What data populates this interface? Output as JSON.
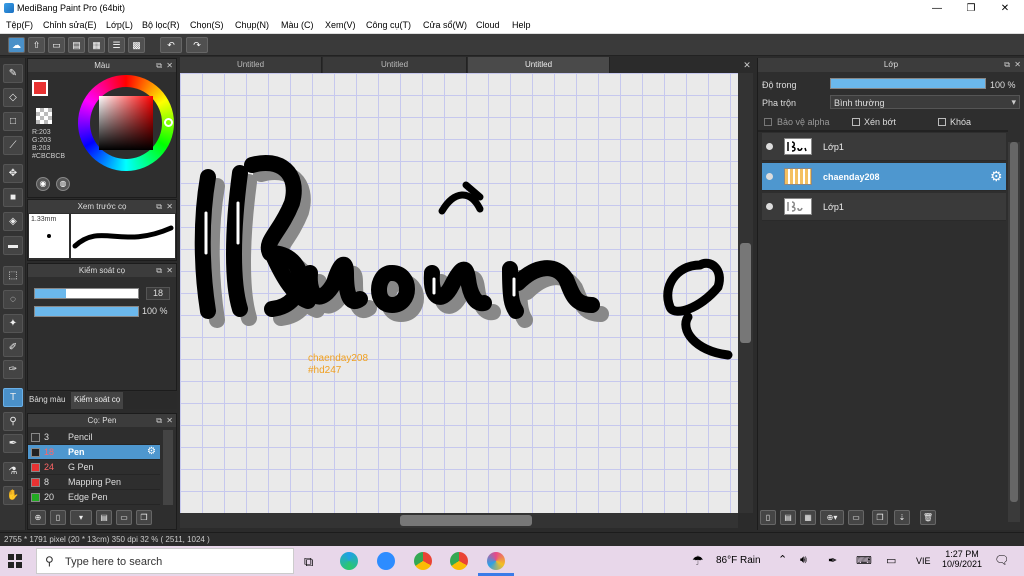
{
  "window": {
    "title": "MediBang Paint Pro (64bit)",
    "min": "—",
    "max": "❐",
    "close": "✕"
  },
  "menu": [
    "Tệp(F)",
    "Chỉnh sửa(E)",
    "Lớp(L)",
    "Bộ lọc(R)",
    "Chọn(S)",
    "Chụp(N)",
    "Màu (C)",
    "Xem(V)",
    "Công cụ(T)",
    "Cửa sổ(W)",
    "Cloud",
    "Help"
  ],
  "tabs": [
    "Untitled",
    "Untitled",
    "Untitled"
  ],
  "color_panel": {
    "title": "Màu",
    "r": "R:203",
    "g": "G:203",
    "b": "B:203",
    "hex": "#CBCBCB"
  },
  "preview_panel": {
    "title": "Xem trước cọ",
    "size": "1.33mm"
  },
  "brush_control": {
    "title": "Kiểm soát cọ",
    "size_value": "18",
    "opacity_value": "100 %",
    "size_fill": 0.3,
    "opacity_fill": 1.0
  },
  "panel_tabs": {
    "palette": "Bảng màu",
    "control": "Kiểm soát cọ"
  },
  "brush_panel": {
    "title": "Cọ: Pen",
    "items": [
      {
        "size": "3",
        "name": "Pencil",
        "color": "#333333"
      },
      {
        "size": "18",
        "name": "Pen",
        "color": "#222222"
      },
      {
        "size": "24",
        "name": "G Pen",
        "color": "#e83232"
      },
      {
        "size": "8",
        "name": "Mapping Pen",
        "color": "#e83232"
      },
      {
        "size": "20",
        "name": "Edge Pen",
        "color": "#22aa22"
      }
    ]
  },
  "layer_panel": {
    "title": "Lớp",
    "opacity_label": "Độ trong",
    "opacity_value": "100 %",
    "opacity_fill": 1.0,
    "blend_label": "Pha trộn",
    "blend_value": "Bình thường",
    "protect_alpha": "Bảo vệ alpha",
    "clip": "Xén bớt",
    "lock": "Khóa",
    "layers": [
      {
        "name": "Lớp1"
      },
      {
        "name": "chaenday208"
      },
      {
        "name": "Lớp1"
      }
    ]
  },
  "canvas": {
    "watermark_line1": "chaenday208",
    "watermark_line2": "#hd247"
  },
  "status": {
    "text": "2755 * 1791 pixel  (20 * 13cm)  350 dpi  32 %  ( 2511, 1024 )"
  },
  "taskbar": {
    "search_placeholder": "Type here to search",
    "weather": "86°F  Rain",
    "lang": "VIE",
    "time": "1:27 PM",
    "date": "10/9/2021"
  }
}
